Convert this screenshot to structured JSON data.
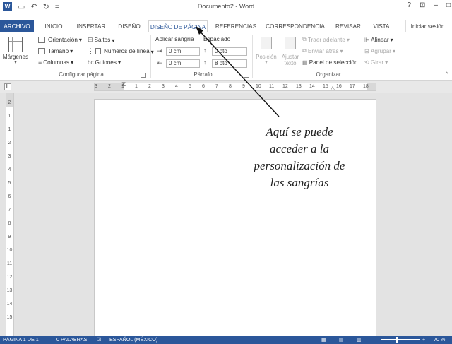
{
  "app": {
    "title": "Documento2 - Word",
    "help": "?",
    "window_controls": [
      "⊡",
      "–",
      "□"
    ]
  },
  "qat": {
    "undo": "↶",
    "redo": "↻",
    "customize": "="
  },
  "tabs": [
    {
      "label": "ARCHIVO"
    },
    {
      "label": "INICIO"
    },
    {
      "label": "INSERTAR"
    },
    {
      "label": "DISEÑO"
    },
    {
      "label": "DISEÑO DE PÁGINA"
    },
    {
      "label": "REFERENCIAS"
    },
    {
      "label": "CORRESPONDENCIA"
    },
    {
      "label": "REVISAR"
    },
    {
      "label": "VISTA"
    }
  ],
  "signin": "Iniciar sesión",
  "ribbon": {
    "margins": "Márgenes",
    "orientation": "Orientación",
    "size": "Tamaño",
    "columns": "Columnas",
    "breaks": "Saltos",
    "line_numbers": "Números de línea",
    "hyphenation": "Guiones",
    "indent_title": "Aplicar sangría",
    "indent_left": "0 cm",
    "indent_right": "0 cm",
    "spacing_title": "Espaciado",
    "spacing_before": "0 pto",
    "spacing_after": "8 pto",
    "position": "Posición",
    "wrap": "Ajustar\ntexto",
    "bring_forward": "Traer adelante",
    "send_backward": "Enviar atrás",
    "selection_pane": "Panel de selección",
    "align": "Alinear",
    "group": "Agrupar",
    "rotate": "Girar",
    "group_page_setup": "Configurar página",
    "group_paragraph": "Párrafo",
    "group_arrange": "Organizar"
  },
  "ruler": {
    "tab_selector": "L",
    "h_labels": [
      "3",
      "2",
      "1",
      "1",
      "2",
      "3",
      "4",
      "5",
      "6",
      "7",
      "8",
      "9",
      "10",
      "11",
      "12",
      "13",
      "14",
      "15",
      "16",
      "17",
      "18"
    ],
    "v_labels": [
      "2",
      "1",
      "1",
      "2",
      "3",
      "4",
      "5",
      "6",
      "7",
      "8",
      "9",
      "10",
      "11",
      "12",
      "13",
      "14",
      "15"
    ]
  },
  "annotation": {
    "lines": [
      "Aquí se puede",
      "acceder a la",
      "personalización de",
      "las sangrías"
    ]
  },
  "status": {
    "page": "PÁGINA 1 DE 1",
    "words": "0 PALABRAS",
    "language": "ESPAÑOL (MÉXICO)",
    "zoom": "70 %"
  },
  "colors": {
    "accent": "#2b579a"
  }
}
